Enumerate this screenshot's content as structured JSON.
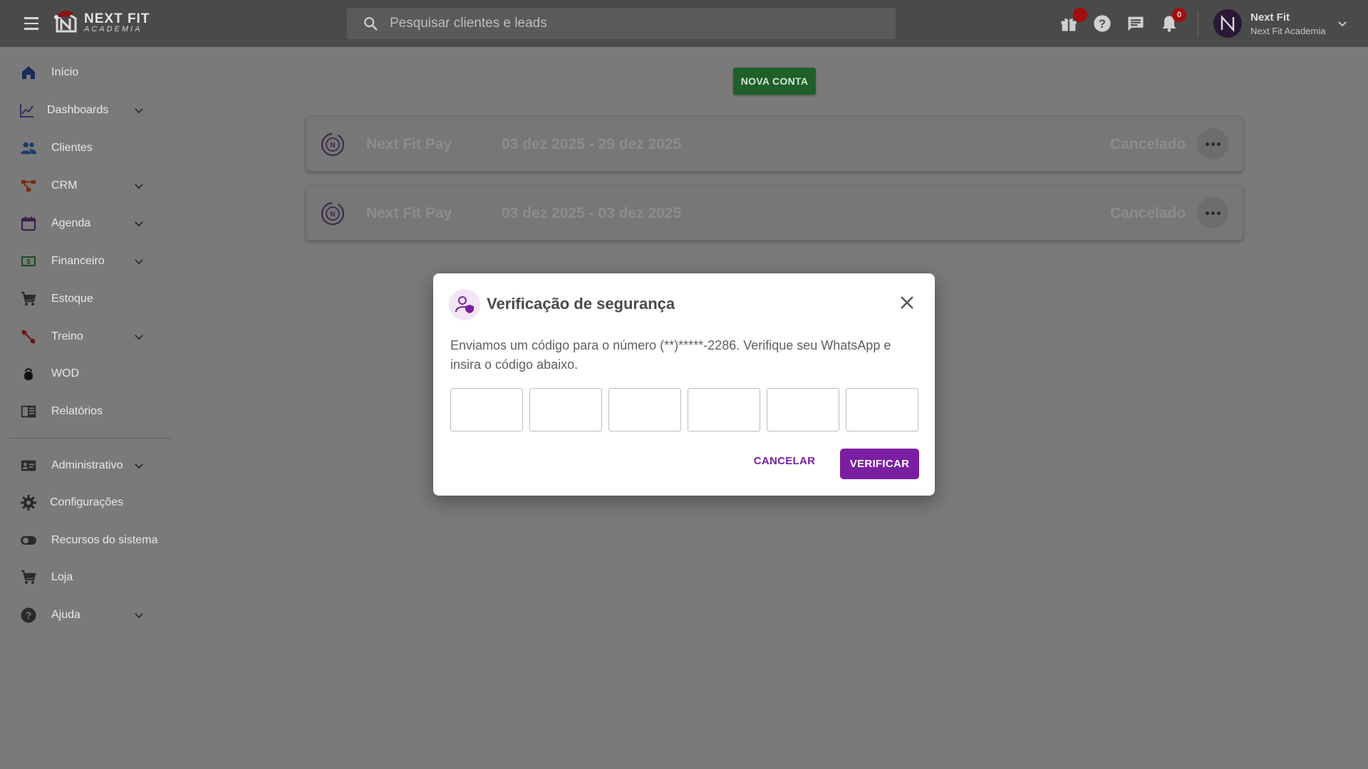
{
  "topbar": {
    "logo_line1": "NEXT FIT",
    "logo_line2": "ACADEMIA",
    "search_placeholder": "Pesquisar clientes e leads",
    "notifications_count": "0",
    "user_name": "Next Fit",
    "user_subtitle": "Next Fit Academia",
    "avatar_icon": "next-fit-logo-icon"
  },
  "sidebar": {
    "items": [
      {
        "label": "Início",
        "icon": "home-icon",
        "expandable": false
      },
      {
        "label": "Dashboards",
        "icon": "chart-line-icon",
        "expandable": true
      },
      {
        "label": "Clientes",
        "icon": "people-icon",
        "expandable": false
      },
      {
        "label": "CRM",
        "icon": "crm-flow-icon",
        "expandable": true
      },
      {
        "label": "Agenda",
        "icon": "calendar-icon",
        "expandable": true
      },
      {
        "label": "Financeiro",
        "icon": "money-icon",
        "expandable": true
      },
      {
        "label": "Estoque",
        "icon": "cart-icon",
        "expandable": false
      },
      {
        "label": "Treino",
        "icon": "dumbbell-icon",
        "expandable": true
      },
      {
        "label": "WOD",
        "icon": "kettlebell-icon",
        "expandable": false
      },
      {
        "label": "Relatórios",
        "icon": "report-icon",
        "expandable": false
      },
      {
        "label": "Administrativo",
        "icon": "id-card-icon",
        "expandable": true
      },
      {
        "label": "Configurações",
        "icon": "gear-icon",
        "expandable": false
      },
      {
        "label": "Recursos do sistema",
        "icon": "toggle-icon",
        "expandable": false
      },
      {
        "label": "Loja",
        "icon": "cart-icon",
        "expandable": false
      },
      {
        "label": "Ajuda",
        "icon": "help-icon",
        "expandable": true
      }
    ]
  },
  "main": {
    "new_account_button": "NOVA CONTA",
    "accounts": [
      {
        "name": "Next Fit Pay",
        "period": "03 dez 2025 - 29 dez 2025",
        "status": "Cancelado"
      },
      {
        "name": "Next Fit Pay",
        "period": "03 dez 2025 - 03 dez 2025",
        "status": "Cancelado"
      }
    ]
  },
  "modal": {
    "title": "Verificação de segurança",
    "message": "Enviamos um código para o número (**)*****-2286. Verifique seu WhatsApp e insira o código abaixo.",
    "code_digits": [
      "",
      "",
      "",
      "",
      "",
      ""
    ],
    "cancel_label": "CANCELAR",
    "verify_label": "VERIFICAR"
  },
  "colors": {
    "accent": "#7b1fa2",
    "topbar": "#4a4a4a",
    "overlay_bg": "#7a7a7a",
    "new_account_green": "#1f5f2a",
    "badge_red": "#a20d0d"
  }
}
